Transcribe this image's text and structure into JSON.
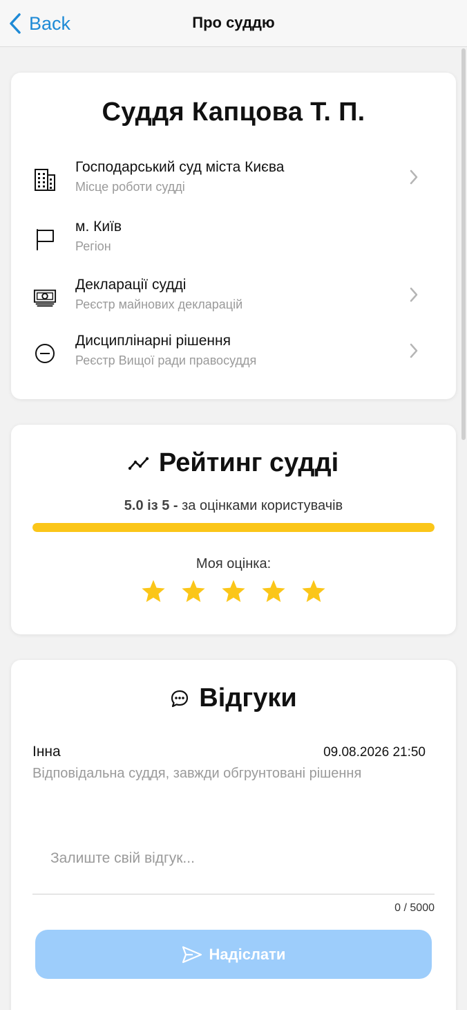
{
  "header": {
    "back_label": "Back",
    "title": "Про суддю"
  },
  "judge": {
    "name": "Суддя Капцова Т. П.",
    "rows": [
      {
        "title": "Господарський суд міста Києва",
        "subtitle": "Місце роботи судді",
        "icon": "building-icon",
        "link": true
      },
      {
        "title": "м. Київ",
        "subtitle": "Регіон",
        "icon": "flag-icon",
        "link": false
      },
      {
        "title": "Декларації судді",
        "subtitle": "Реєстр майнових декларацій",
        "icon": "money-icon",
        "link": true
      },
      {
        "title": "Дисциплінарні рішення",
        "subtitle": "Реєстр Вищої ради правосуддя",
        "icon": "minus-circle-icon",
        "link": true
      }
    ]
  },
  "rating": {
    "title": "Рейтинг судді",
    "score_text": "5.0 із 5 -",
    "score_suffix": "за оцінками користувачів",
    "score_value": 5.0,
    "score_max": 5,
    "my_rating_label": "Моя оцінка:",
    "my_rating": 5,
    "colors": {
      "accent": "#fbc619"
    }
  },
  "reviews": {
    "title": "Відгуки",
    "items": [
      {
        "author": "Інна",
        "date": "09.08.2026 21:50",
        "text": "Відповідальна суддя, завжди обгрунтовані рішення"
      }
    ],
    "input_placeholder": "Залиште свій відгук...",
    "char_count": "0 / 5000",
    "send_label": "Надіслати"
  }
}
